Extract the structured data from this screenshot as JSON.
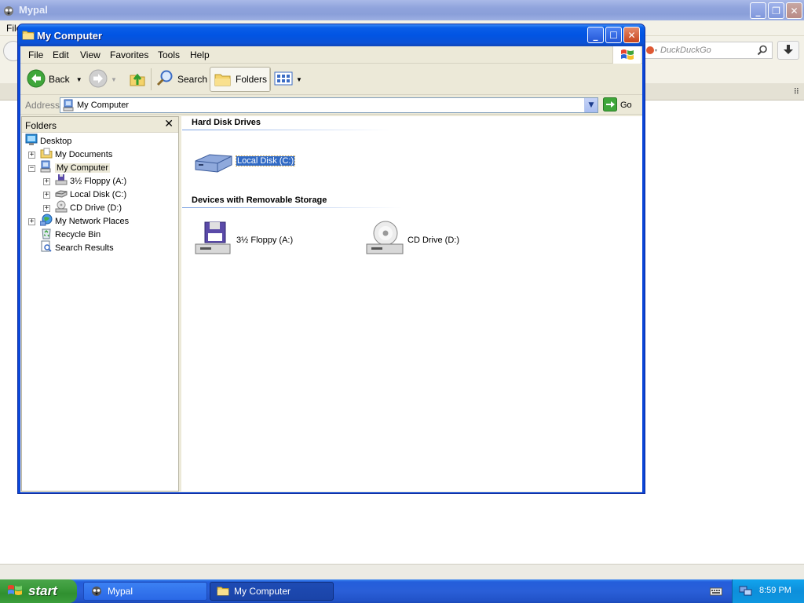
{
  "browser": {
    "title": "Mypal",
    "menu_first": "File",
    "search_placeholder": "DuckDuckGo"
  },
  "window": {
    "title": "My Computer",
    "menu": [
      "File",
      "Edit",
      "View",
      "Favorites",
      "Tools",
      "Help"
    ],
    "toolbar": {
      "back": "Back",
      "search": "Search",
      "folders": "Folders"
    },
    "address": {
      "label": "Address",
      "value": "My Computer",
      "go": "Go"
    },
    "folders_pane": {
      "title": "Folders",
      "items": [
        {
          "label": "Desktop"
        },
        {
          "label": "My Documents"
        },
        {
          "label": "My Computer"
        },
        {
          "label": "3½ Floppy (A:)"
        },
        {
          "label": "Local Disk (C:)"
        },
        {
          "label": "CD Drive (D:)"
        },
        {
          "label": "My Network Places"
        },
        {
          "label": "Recycle Bin"
        },
        {
          "label": "Search Results"
        }
      ]
    },
    "content": {
      "groups": [
        {
          "title": "Hard Disk Drives",
          "items": [
            {
              "label": "Local Disk (C:)",
              "selected": true
            }
          ]
        },
        {
          "title": "Devices with Removable Storage",
          "items": [
            {
              "label": "3½ Floppy (A:)"
            },
            {
              "label": "CD Drive (D:)"
            }
          ]
        }
      ]
    }
  },
  "taskbar": {
    "start": "start",
    "tasks": [
      {
        "label": "Mypal"
      },
      {
        "label": "My Computer"
      }
    ],
    "clock": "8:59 PM"
  },
  "colors": {
    "xp_blue": "#0a46d8",
    "selection": "#316ac5",
    "start_green": "#3a9a3a"
  }
}
